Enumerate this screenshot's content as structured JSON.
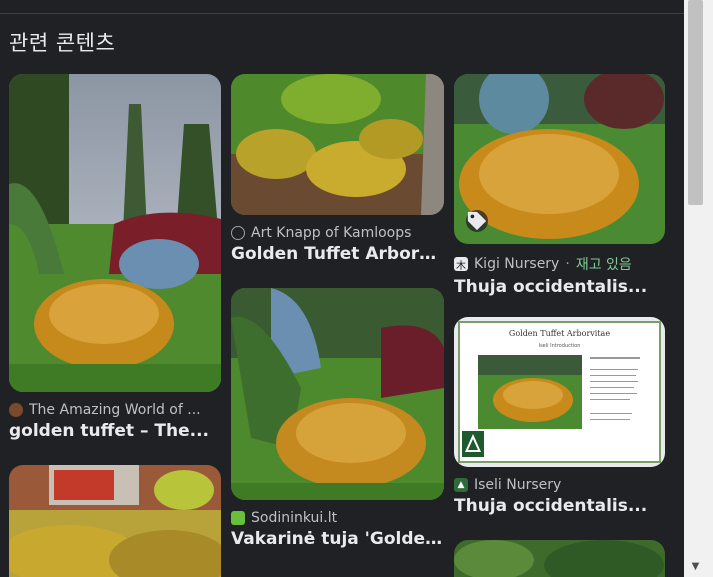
{
  "section": {
    "title": "관련 콘텐츠"
  },
  "cards": [
    {
      "source": "The Amazing World of ...",
      "title": "golden tuffet – The...",
      "favicon_color": "#7a4a2a"
    },
    {
      "source": "Art Knapp of Kamloops",
      "title": "Golden Tuffet Arborvita...",
      "favicon_color": "#9aa0a6"
    },
    {
      "source": "Kigi Nursery",
      "stock": "재고 있음",
      "title": "Thuja occidentalis...",
      "favicon_color": "#e8eaed"
    },
    {
      "source": "Sodininkui.lt",
      "title": "Vakarinė tuja 'Golden...",
      "favicon_color": "#6abf3a"
    },
    {
      "source": "Iseli Nursery",
      "title": "Thuja occidentalis...",
      "favicon_color": "#3a7a3a",
      "doc_title": "Golden Tuffet Arborvitae",
      "doc_subtitle": "Iseli Introduction"
    }
  ],
  "scrollbar": {
    "thumb_fraction_top": 0.0,
    "thumb_fraction_size": 0.36
  }
}
